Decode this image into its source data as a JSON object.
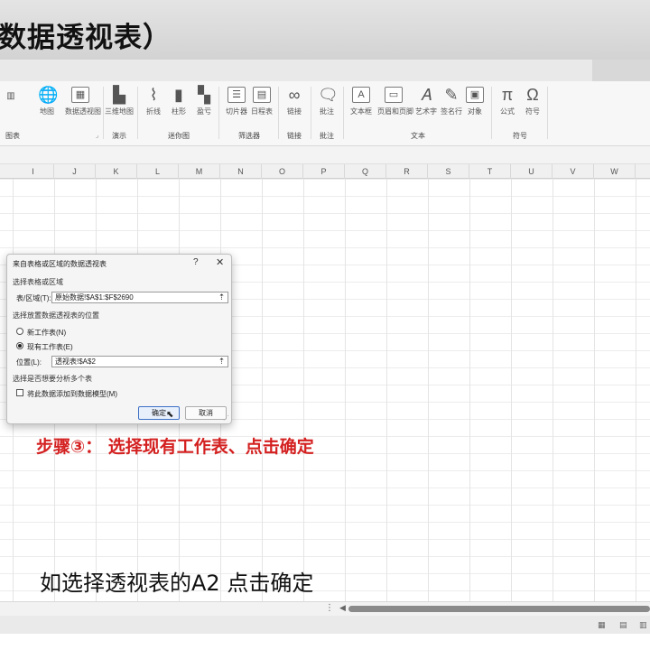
{
  "video": {
    "title": "数据透视表）",
    "step_caption": "步骤③： 选择现有工作表、点击确定",
    "subtitle": "如选择透视表的A2 点击确定"
  },
  "ribbon": {
    "buttons": [
      {
        "label": "地图",
        "icon": "map-icon"
      },
      {
        "label": "数据透视图",
        "icon": "pivot-chart-icon"
      },
      {
        "label": "三维地图",
        "icon": "3d-map-icon"
      },
      {
        "label": "折线",
        "icon": "sparkline-line-icon"
      },
      {
        "label": "柱形",
        "icon": "sparkline-column-icon"
      },
      {
        "label": "盈亏",
        "icon": "sparkline-winloss-icon"
      },
      {
        "label": "切片器",
        "icon": "slicer-icon"
      },
      {
        "label": "日程表",
        "icon": "timeline-icon"
      },
      {
        "label": "链接",
        "icon": "link-icon"
      },
      {
        "label": "批注",
        "icon": "comment-icon"
      },
      {
        "label": "文本框",
        "icon": "textbox-icon"
      },
      {
        "label": "页眉和页脚",
        "icon": "header-footer-icon"
      },
      {
        "label": "艺术字",
        "icon": "wordart-icon"
      },
      {
        "label": "签名行",
        "icon": "signature-icon"
      },
      {
        "label": "对象",
        "icon": "object-icon"
      },
      {
        "label": "公式",
        "icon": "pi-icon"
      },
      {
        "label": "符号",
        "icon": "omega-icon"
      }
    ],
    "groups": [
      "图表",
      "演示",
      "迷你图",
      "筛选器",
      "链接",
      "批注",
      "文本",
      "符号"
    ]
  },
  "sheet": {
    "columns": [
      "I",
      "J",
      "K",
      "L",
      "M",
      "N",
      "O",
      "P",
      "Q",
      "R",
      "S",
      "T",
      "U",
      "V",
      "W"
    ]
  },
  "dialog": {
    "title": "来自表格或区域的数据透视表",
    "help": "?",
    "close": "✕",
    "section_source": "选择表格或区域",
    "range_label": "表/区域(T):",
    "range_value": "原始数据!$A$1:$F$2690",
    "section_location": "选择放置数据透视表的位置",
    "option_new": "新工作表(N)",
    "option_existing": "现有工作表(E)",
    "location_label": "位置(L):",
    "location_value": "透视表!$A$2",
    "section_multi": "选择是否想要分析多个表",
    "datamodel_label": "将此数据添加到数据模型(M)",
    "ok": "确定",
    "cancel": "取消"
  }
}
